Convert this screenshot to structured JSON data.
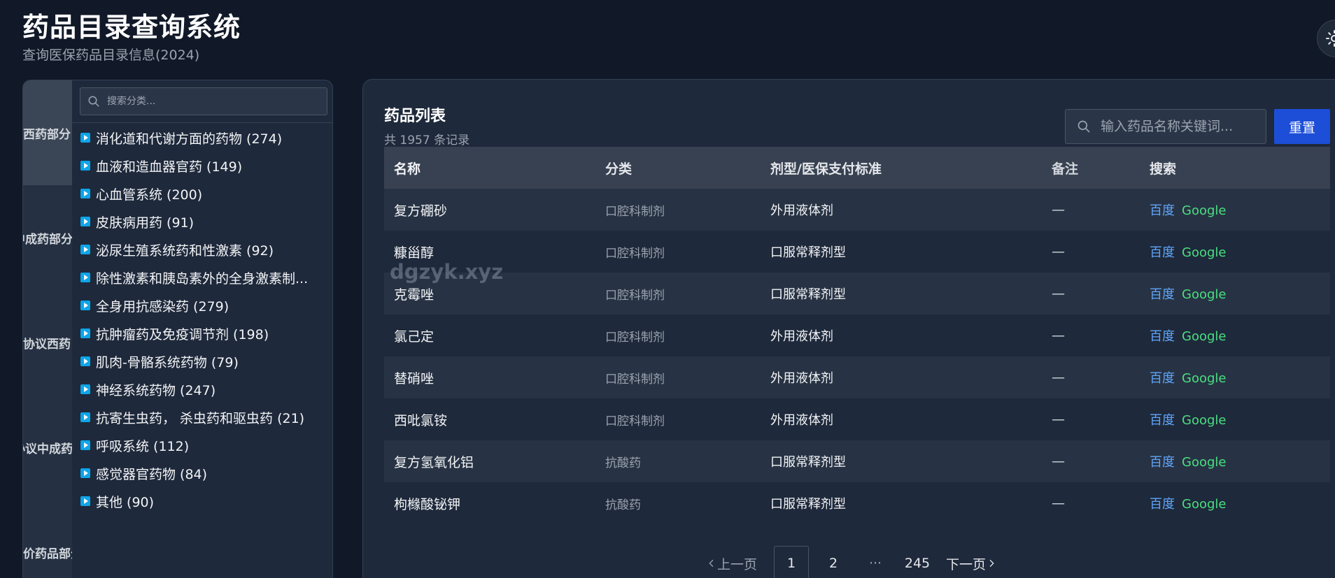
{
  "header": {
    "title": "药品目录查询系统",
    "subtitle": "查询医保药品目录信息(2024)"
  },
  "sidebar": {
    "tabs": [
      {
        "label": "西药部分",
        "active": true
      },
      {
        "label": "中成药部分",
        "active": false
      },
      {
        "label": "协议西药",
        "active": false
      },
      {
        "label": "协议中成药",
        "active": false
      },
      {
        "label": "价药品部分",
        "active": false
      }
    ],
    "search_placeholder": "搜索分类...",
    "categories": [
      {
        "label": "消化道和代谢方面的药物 (274)"
      },
      {
        "label": "血液和造血器官药 (149)"
      },
      {
        "label": "心血管系统 (200)"
      },
      {
        "label": "皮肤病用药 (91)"
      },
      {
        "label": "泌尿生殖系统药和性激素 (92)"
      },
      {
        "label": "除性激素和胰岛素外的全身激素制..."
      },
      {
        "label": "全身用抗感染药 (279)"
      },
      {
        "label": "抗肿瘤药及免疫调节剂 (198)"
      },
      {
        "label": "肌肉-骨骼系统药物 (79)"
      },
      {
        "label": "神经系统药物 (247)"
      },
      {
        "label": "抗寄生虫药， 杀虫药和驱虫药 (21)"
      },
      {
        "label": "呼吸系统 (112)"
      },
      {
        "label": "感觉器官药物 (84)"
      },
      {
        "label": "其他 (90)"
      }
    ]
  },
  "main": {
    "title": "药品列表",
    "record_count": "共 1957 条记录",
    "search_placeholder": "输入药品名称关键词...",
    "reset_label": "重置",
    "watermark": "dgzyk.xyz",
    "table": {
      "columns": [
        "名称",
        "分类",
        "剂型/医保支付标准",
        "备注",
        "搜索"
      ],
      "rows": [
        {
          "name": "复方硼砂",
          "category": "口腔科制剂",
          "form": "外用液体剂",
          "note": "—",
          "baidu": "百度",
          "google": "Google"
        },
        {
          "name": "糠甾醇",
          "category": "口腔科制剂",
          "form": "口服常释剂型",
          "note": "—",
          "baidu": "百度",
          "google": "Google"
        },
        {
          "name": "克霉唑",
          "category": "口腔科制剂",
          "form": "口服常释剂型",
          "note": "—",
          "baidu": "百度",
          "google": "Google"
        },
        {
          "name": "氯己定",
          "category": "口腔科制剂",
          "form": "外用液体剂",
          "note": "—",
          "baidu": "百度",
          "google": "Google"
        },
        {
          "name": "替硝唑",
          "category": "口腔科制剂",
          "form": "外用液体剂",
          "note": "—",
          "baidu": "百度",
          "google": "Google"
        },
        {
          "name": "西吡氯铵",
          "category": "口腔科制剂",
          "form": "外用液体剂",
          "note": "—",
          "baidu": "百度",
          "google": "Google"
        },
        {
          "name": "复方氢氧化铝",
          "category": "抗酸药",
          "form": "口服常释剂型",
          "note": "—",
          "baidu": "百度",
          "google": "Google"
        },
        {
          "name": "枸橼酸铋钾",
          "category": "抗酸药",
          "form": "口服常释剂型",
          "note": "—",
          "baidu": "百度",
          "google": "Google"
        }
      ]
    },
    "pagination": {
      "prev_label": "上一页",
      "pages": [
        "1",
        "2"
      ],
      "current": "1",
      "ellipsis": "···",
      "last_page": "245",
      "next_label": "下一页"
    }
  },
  "colors": {
    "background": "#111827",
    "panel": "#1e293b",
    "accent": "#1d4ed8",
    "baidu_link": "#60a5fa",
    "google_link": "#4ade80",
    "category_icon": "#0ea5e9"
  },
  "icons": [
    "search-icon",
    "play-icon",
    "sun-icon",
    "chevron-left-icon",
    "chevron-right-icon"
  ]
}
